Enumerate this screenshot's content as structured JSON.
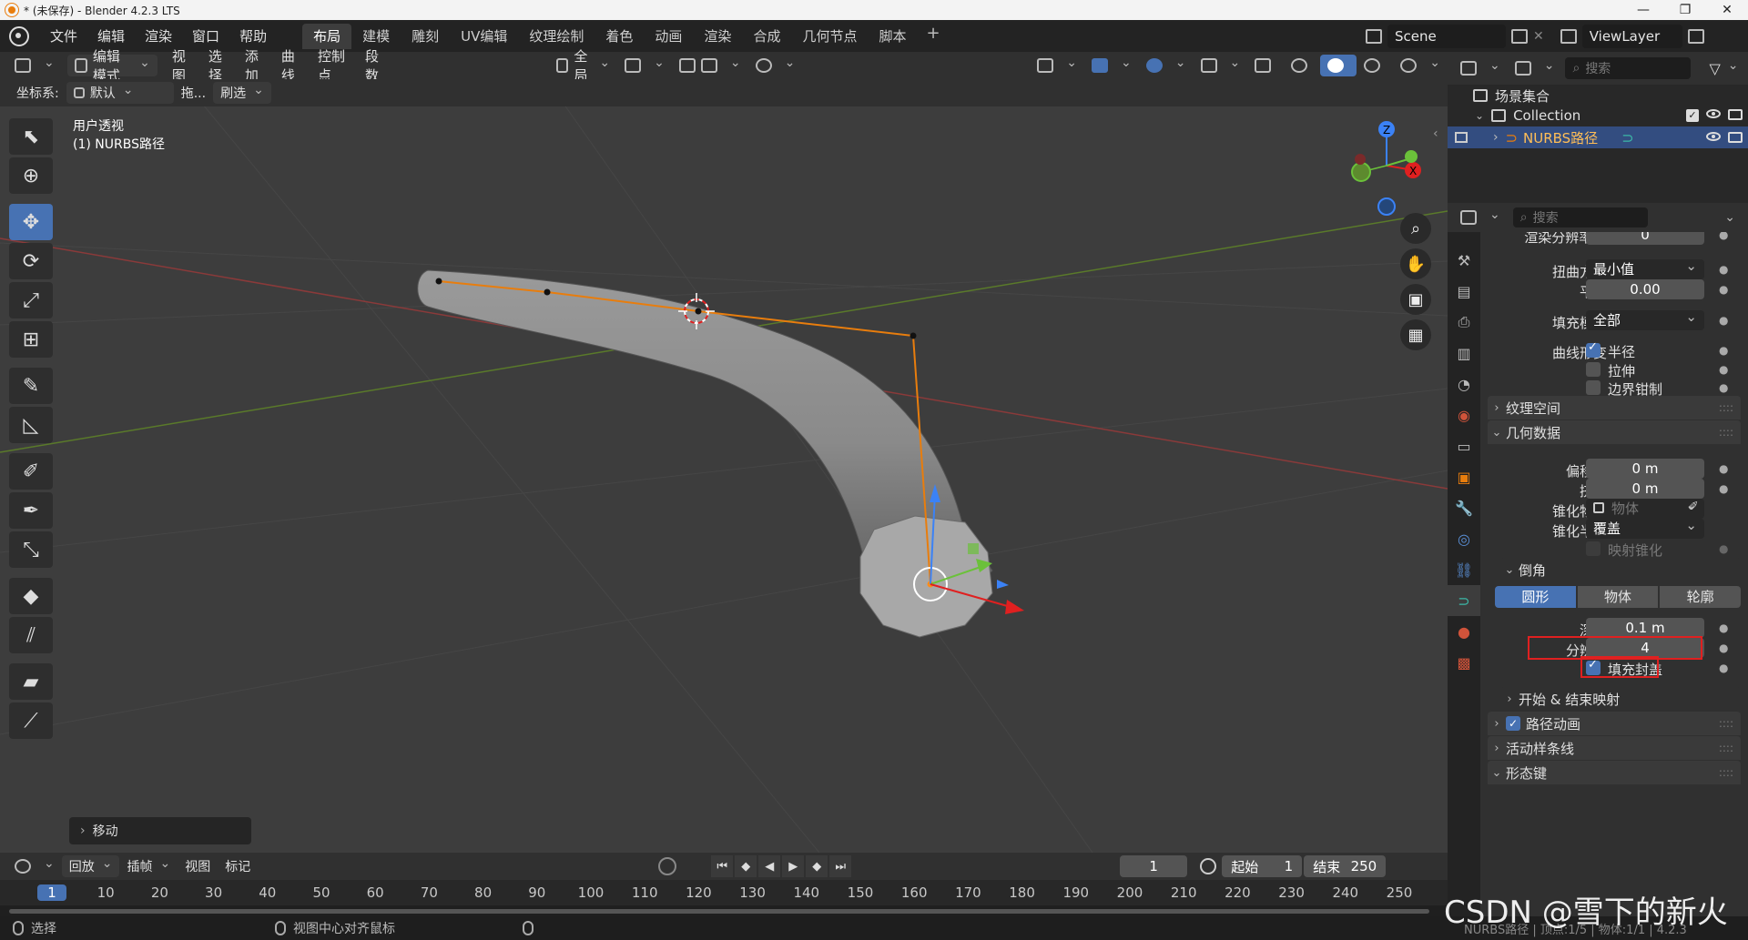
{
  "window": {
    "title": "* (未保存) - Blender 4.2.3 LTS",
    "minimize": "—",
    "maximize": "❐",
    "close": "✕"
  },
  "topbar": {
    "menus": [
      "文件",
      "编辑",
      "渲染",
      "窗口",
      "帮助"
    ],
    "workspaces": [
      "布局",
      "建模",
      "雕刻",
      "UV编辑",
      "纹理绘制",
      "着色",
      "动画",
      "渲染",
      "合成",
      "几何节点",
      "脚本"
    ],
    "active_workspace": "布局",
    "add": "+",
    "scene": "Scene",
    "view_layer": "ViewLayer"
  },
  "viewport_header": {
    "mode": "编辑模式",
    "menus": [
      "视图",
      "选择",
      "添加",
      "曲线",
      "控制点",
      "段数"
    ],
    "transform_orientation": "全局",
    "coord_label": "坐标系:",
    "coord_value": "默认",
    "drag_label": "拖...",
    "select_mode": "刷选"
  },
  "viewport": {
    "view_name": "用户透视",
    "object_label": "(1) NURBS路径",
    "last_operator": "移动",
    "gizmo_z": "Z",
    "gizmo_x": "X",
    "gizmo_y": "Y"
  },
  "toolbar": {
    "tools": [
      "select-tool",
      "cursor-tool",
      "move-tool",
      "rotate-tool",
      "scale-tool",
      "transform-tool",
      "annotate-tool",
      "measure-tool",
      "draw-tool",
      "pen-tool",
      "extrude-tool",
      "radius-tool",
      "tilt-tool",
      "randomize-tool",
      "shear-tool"
    ],
    "active": "move-tool"
  },
  "timeline": {
    "menus": [
      "回放",
      "插帧",
      "视图",
      "标记"
    ],
    "current_frame": "1",
    "start_label": "起始",
    "start": "1",
    "end_label": "结束",
    "end": "250",
    "ticks": [
      "1",
      "10",
      "20",
      "30",
      "40",
      "50",
      "60",
      "70",
      "80",
      "90",
      "100",
      "110",
      "120",
      "130",
      "140",
      "150",
      "160",
      "170",
      "180",
      "190",
      "200",
      "210",
      "220",
      "230",
      "240",
      "250"
    ]
  },
  "statusbar": {
    "select": "选择",
    "center_view": "视图中心对齐鼠标",
    "stats": "NURBS路径 | 顶点:1/5 | 物体:1/1 | 4.2.3"
  },
  "outliner": {
    "search_placeholder": "搜索",
    "scene_collection": "场景集合",
    "collection": "Collection",
    "object": "NURBS路径"
  },
  "properties": {
    "search_placeholder": "搜索",
    "render_resolution_label": "渲染分辨率 U",
    "render_resolution_value": "0",
    "twist_method_label": "扭曲方法",
    "twist_method_value": "最小值",
    "smooth_label": "平滑",
    "smooth_value": "0.00",
    "fill_mode_label": "填充模式",
    "fill_mode_value": "全部",
    "curve_deform_label": "曲线形变",
    "radius": "半径",
    "stretch": "拉伸",
    "bounds_clamp": "边界钳制",
    "texture_space": "纹理空间",
    "geometry": "几何数据",
    "offset_label": "偏移量",
    "offset_value": "0 m",
    "extrude_label": "挤出",
    "extrude_value": "0 m",
    "taper_object_label": "锥化物体",
    "taper_object_placeholder": "物体",
    "taper_radius_label": "锥化半径",
    "taper_radius_value": "覆盖",
    "map_taper": "映射锥化",
    "bevel": "倒角",
    "bevel_modes": [
      "圆形",
      "物体",
      "轮廓"
    ],
    "bevel_mode_active": "圆形",
    "depth_label": "深度",
    "depth_value": "0.1 m",
    "resolution_label": "分辨率",
    "resolution_value": "4",
    "fill_caps": "填充封盖",
    "start_end_mapping": "开始 & 结束映射",
    "path_animation": "路径动画",
    "active_spline": "活动样条线",
    "shape_keys": "形态键"
  },
  "watermark": "CSDN @雪下的新火",
  "colors": {
    "accent": "#4772b3",
    "highlight": "#e02020",
    "curve": "#e87d0d",
    "viewport_bg": "#3d3d3d"
  }
}
